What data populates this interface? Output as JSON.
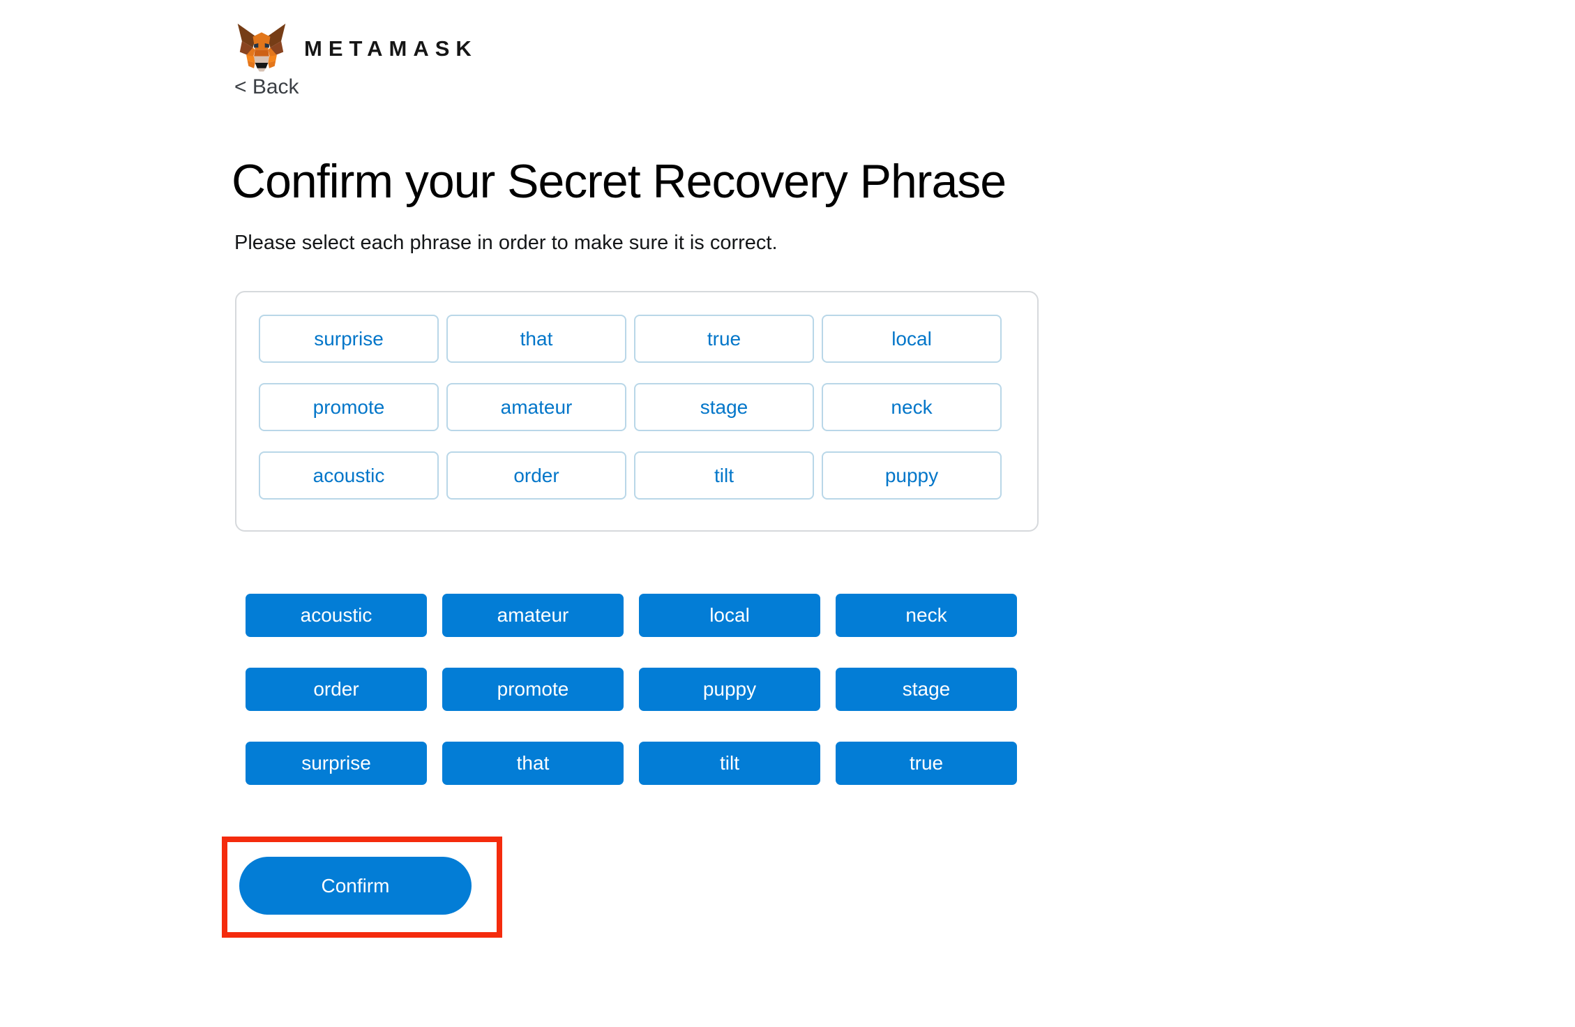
{
  "brand": {
    "wordmark": "METAMASK",
    "logo_icon": "metamask-fox-icon",
    "back_label": "< Back"
  },
  "heading": {
    "title": "Confirm your Secret Recovery Phrase",
    "subtitle": "Please select each phrase in order to make sure it is correct."
  },
  "selected_phrase": {
    "words": [
      "surprise",
      "that",
      "true",
      "local",
      "promote",
      "amateur",
      "stage",
      "neck",
      "acoustic",
      "order",
      "tilt",
      "puppy"
    ]
  },
  "word_bank": {
    "words": [
      "acoustic",
      "amateur",
      "local",
      "neck",
      "order",
      "promote",
      "puppy",
      "stage",
      "surprise",
      "that",
      "tilt",
      "true"
    ]
  },
  "actions": {
    "confirm_label": "Confirm"
  },
  "colors": {
    "primary_blue": "#037dd6",
    "slot_text_blue": "#0376c9",
    "slot_border": "#b9d7e8",
    "panel_border": "#d6d9dc",
    "highlight_red": "#f42b0d",
    "fox_orange": "#e2761b",
    "fox_dark": "#763d16"
  }
}
